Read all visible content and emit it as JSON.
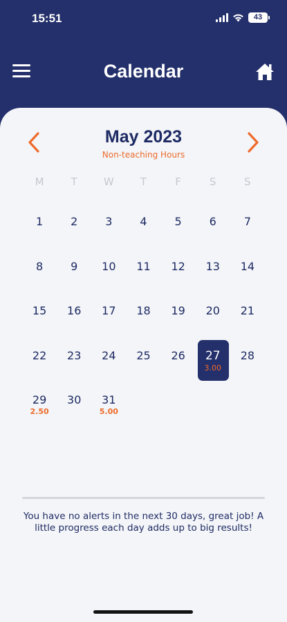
{
  "status_bar": {
    "time": "15:51",
    "battery": "43"
  },
  "header": {
    "title": "Calendar",
    "menu_icon": "hamburger-menu-icon",
    "home_icon": "home-icon"
  },
  "calendar": {
    "month_title": "May 2023",
    "subtitle": "Non-teaching Hours",
    "weekdays": [
      "M",
      "T",
      "W",
      "T",
      "F",
      "S",
      "S"
    ],
    "selected_day": "27",
    "days": [
      {
        "num": "1",
        "hours": ""
      },
      {
        "num": "2",
        "hours": ""
      },
      {
        "num": "3",
        "hours": ""
      },
      {
        "num": "4",
        "hours": ""
      },
      {
        "num": "5",
        "hours": ""
      },
      {
        "num": "6",
        "hours": ""
      },
      {
        "num": "7",
        "hours": ""
      },
      {
        "num": "8",
        "hours": ""
      },
      {
        "num": "9",
        "hours": ""
      },
      {
        "num": "10",
        "hours": ""
      },
      {
        "num": "11",
        "hours": ""
      },
      {
        "num": "12",
        "hours": ""
      },
      {
        "num": "13",
        "hours": ""
      },
      {
        "num": "14",
        "hours": ""
      },
      {
        "num": "15",
        "hours": ""
      },
      {
        "num": "16",
        "hours": ""
      },
      {
        "num": "17",
        "hours": ""
      },
      {
        "num": "18",
        "hours": ""
      },
      {
        "num": "19",
        "hours": ""
      },
      {
        "num": "20",
        "hours": ""
      },
      {
        "num": "21",
        "hours": ""
      },
      {
        "num": "22",
        "hours": ""
      },
      {
        "num": "23",
        "hours": ""
      },
      {
        "num": "24",
        "hours": ""
      },
      {
        "num": "25",
        "hours": ""
      },
      {
        "num": "26",
        "hours": ""
      },
      {
        "num": "27",
        "hours": "3.00"
      },
      {
        "num": "28",
        "hours": ""
      },
      {
        "num": "29",
        "hours": "2.50"
      },
      {
        "num": "30",
        "hours": ""
      },
      {
        "num": "31",
        "hours": "5.00"
      }
    ]
  },
  "alert": {
    "message": "You have no alerts in the next 30 days, great job! A little progress each day adds up to big results!"
  },
  "colors": {
    "navy": "#24306b",
    "orange": "#ee6a2a",
    "background": "#f3f5f8"
  }
}
